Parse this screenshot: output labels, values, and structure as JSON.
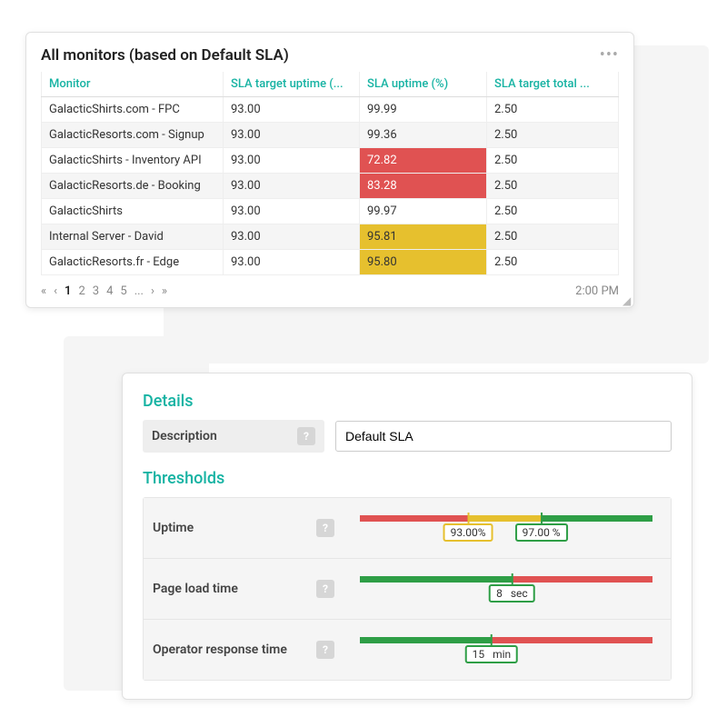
{
  "monitors": {
    "title": "All monitors (based on Default SLA)",
    "columns": [
      "Monitor",
      "SLA target uptime (...",
      "SLA uptime (%)",
      "SLA target total ..."
    ],
    "rows": [
      {
        "name": "GalacticShirts.com - FPC",
        "target": "93.00",
        "uptime": "99.99",
        "status": "",
        "total": "2.50"
      },
      {
        "name": "GalacticResorts.com - Signup",
        "target": "93.00",
        "uptime": "99.36",
        "status": "",
        "total": "2.50"
      },
      {
        "name": "GalacticShirts - Inventory API",
        "target": "93.00",
        "uptime": "72.82",
        "status": "critical",
        "total": "2.50"
      },
      {
        "name": "GalacticResorts.de - Booking",
        "target": "93.00",
        "uptime": "83.28",
        "status": "critical",
        "total": "2.50"
      },
      {
        "name": "GalacticShirts",
        "target": "93.00",
        "uptime": "99.97",
        "status": "",
        "total": "2.50"
      },
      {
        "name": "Internal Server - David",
        "target": "93.00",
        "uptime": "95.81",
        "status": "warning",
        "total": "2.50"
      },
      {
        "name": "GalacticResorts.fr - Edge",
        "target": "93.00",
        "uptime": "95.80",
        "status": "warning",
        "total": "2.50"
      }
    ],
    "pager": {
      "first": "«",
      "prev": "‹",
      "pages": [
        "1",
        "2",
        "3",
        "4",
        "5",
        "..."
      ],
      "next": "›",
      "last": "»"
    },
    "timestamp": "2:00 PM"
  },
  "details": {
    "section_details": "Details",
    "description_label": "Description",
    "description_value": "Default SLA",
    "section_thresholds": "Thresholds",
    "uptime_label": "Uptime",
    "uptime_low": "93.00",
    "uptime_low_unit": "%",
    "uptime_high": "97.00",
    "uptime_high_unit": " %",
    "pageload_label": "Page load time",
    "pageload_val": "8",
    "pageload_unit": "sec",
    "opresp_label": "Operator response time",
    "opresp_val": "15",
    "opresp_unit": "min",
    "help_glyph": "?"
  }
}
